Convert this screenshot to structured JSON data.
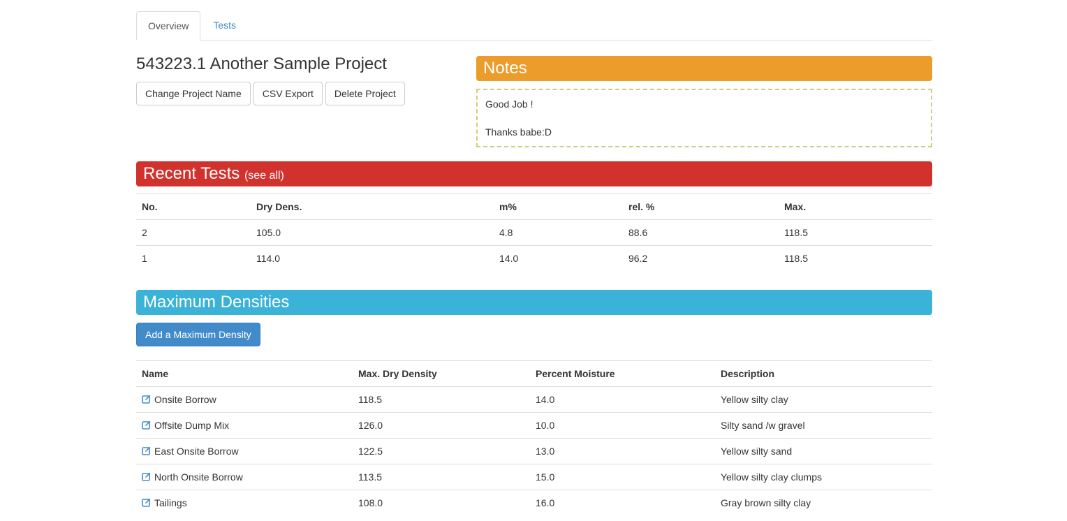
{
  "tabs": [
    {
      "label": "Overview",
      "active": true
    },
    {
      "label": "Tests",
      "active": false
    }
  ],
  "project": {
    "title": "543223.1 Another Sample Project",
    "buttons": {
      "change_name": "Change Project Name",
      "csv_export": "CSV Export",
      "delete": "Delete Project"
    }
  },
  "notes": {
    "heading": "Notes",
    "lines": [
      "Good Job !",
      "Thanks babe:D"
    ]
  },
  "recent_tests": {
    "heading": "Recent Tests",
    "see_all": "(see all)",
    "columns": [
      "No.",
      "Dry Dens.",
      "m%",
      "rel. %",
      "Max."
    ],
    "rows": [
      [
        "2",
        "105.0",
        "4.8",
        "88.6",
        "118.5"
      ],
      [
        "1",
        "114.0",
        "14.0",
        "96.2",
        "118.5"
      ]
    ]
  },
  "max_densities": {
    "heading": "Maximum Densities",
    "add_button": "Add a Maximum Density",
    "columns": [
      "Name",
      "Max. Dry Density",
      "Percent Moisture",
      "Description"
    ],
    "rows": [
      [
        "Onsite Borrow",
        "118.5",
        "14.0",
        "Yellow silty clay"
      ],
      [
        "Offsite Dump Mix",
        "126.0",
        "10.0",
        "Silty sand /w gravel"
      ],
      [
        "East Onsite Borrow",
        "122.5",
        "13.0",
        "Yellow silty sand"
      ],
      [
        "North Onsite Borrow",
        "113.5",
        "15.0",
        "Yellow silty clay clumps"
      ],
      [
        "Tailings",
        "108.0",
        "16.0",
        "Gray brown silty clay"
      ]
    ],
    "row_icon": "edit-icon"
  },
  "colors": {
    "notes_bar": "#ec9c2a",
    "recent_bar": "#d2322d",
    "maxd_bar": "#3bb2d8",
    "link": "#428bca",
    "primary_button": "#428bca",
    "notes_border": "#d0cc7f"
  }
}
